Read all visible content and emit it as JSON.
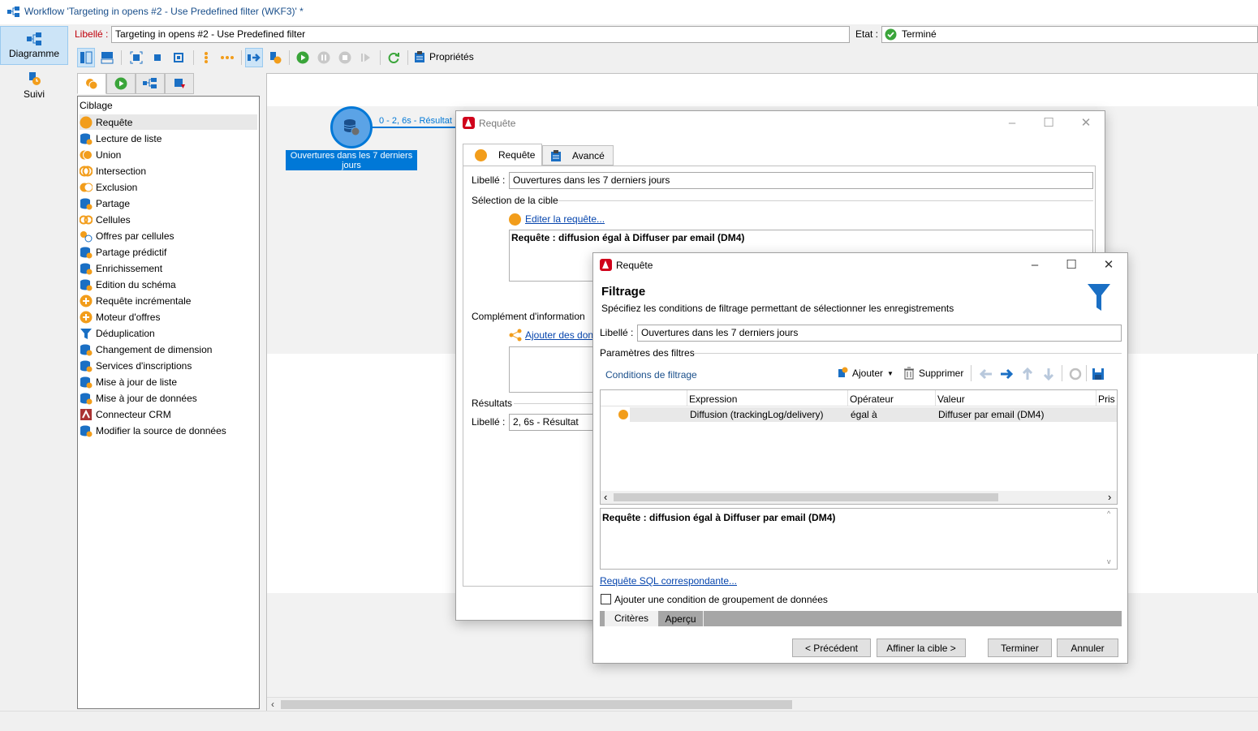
{
  "window": {
    "title": "Workflow 'Targeting in opens #2 - Use Predefined filter (WKF3)' *"
  },
  "side_nav": [
    {
      "label": "Diagramme",
      "icon": "diagram-icon"
    },
    {
      "label": "Suivi",
      "icon": "tracking-icon"
    }
  ],
  "header": {
    "libelle_label": "Libellé :",
    "libelle_value": "Targeting in opens #2 - Use Predefined filter",
    "etat_label": "Etat :",
    "etat_value": "Terminé"
  },
  "toolbar": {
    "properties_label": "Propriétés"
  },
  "palette": {
    "group": "Ciblage",
    "items": [
      {
        "label": "Requête",
        "icon": "query-icon"
      },
      {
        "label": "Lecture de liste",
        "icon": "list-read-icon"
      },
      {
        "label": "Union",
        "icon": "union-icon"
      },
      {
        "label": "Intersection",
        "icon": "intersection-icon"
      },
      {
        "label": "Exclusion",
        "icon": "exclusion-icon"
      },
      {
        "label": "Partage",
        "icon": "split-icon"
      },
      {
        "label": "Cellules",
        "icon": "cells-icon"
      },
      {
        "label": "Offres par cellules",
        "icon": "offers-cells-icon"
      },
      {
        "label": "Partage prédictif",
        "icon": "predictive-split-icon"
      },
      {
        "label": "Enrichissement",
        "icon": "enrichment-icon"
      },
      {
        "label": "Edition du schéma",
        "icon": "schema-edit-icon"
      },
      {
        "label": "Requête incrémentale",
        "icon": "incremental-query-icon"
      },
      {
        "label": "Moteur d'offres",
        "icon": "offer-engine-icon"
      },
      {
        "label": "Déduplication",
        "icon": "deduplication-icon"
      },
      {
        "label": "Changement de dimension",
        "icon": "dimension-change-icon"
      },
      {
        "label": "Services d'inscriptions",
        "icon": "subscription-services-icon"
      },
      {
        "label": "Mise à jour de liste",
        "icon": "list-update-icon"
      },
      {
        "label": "Mise à jour de données",
        "icon": "data-update-icon"
      },
      {
        "label": "Connecteur CRM",
        "icon": "crm-connector-icon"
      },
      {
        "label": "Modifier la source de données",
        "icon": "change-datasource-icon"
      }
    ]
  },
  "canvas": {
    "node_label": "Ouvertures dans les 7 derniers jours",
    "transition_label": "0 - 2, 6s - Résultat"
  },
  "query_dialog": {
    "title": "Requête",
    "tabs": [
      "Requête",
      "Avancé"
    ],
    "libelle_label": "Libellé :",
    "libelle_value": "Ouvertures dans les 7 derniers jours",
    "target_section": "Sélection de la cible",
    "edit_link": "Editer la requête...",
    "query_text": "Requête : diffusion égal à Diffuser par email (DM4)",
    "complement_section": "Complément d'information",
    "add_data_link": "Ajouter des don",
    "results_section": "Résultats",
    "result_label": "Libellé :",
    "result_value": "2, 6s - Résultat"
  },
  "filter_dialog": {
    "title": "Requête",
    "heading": "Filtrage",
    "subheading": "Spécifiez les conditions de filtrage permettant de sélectionner les enregistrements",
    "libelle_label": "Libellé :",
    "libelle_value": "Ouvertures dans les 7 derniers jours",
    "params_section": "Paramètres des filtres",
    "conditions_label": "Conditions de filtrage",
    "add_label": "Ajouter",
    "delete_label": "Supprimer",
    "columns": [
      "Expression",
      "Opérateur",
      "Valeur",
      "Pris"
    ],
    "rows": [
      {
        "expression": "Diffusion (trackingLog/delivery)",
        "operator": "égal à",
        "value": "Diffuser par email (DM4)"
      }
    ],
    "query_text": "Requête : diffusion égal à Diffuser par email (DM4)",
    "sql_link": "Requête SQL correspondante...",
    "group_checkbox_label": "Ajouter une condition de groupement de données",
    "bottom_tabs": [
      "Critères",
      "Aperçu"
    ],
    "buttons": {
      "previous": "< Précédent",
      "refine": "Affiner la cible >",
      "finish": "Terminer",
      "cancel": "Annuler"
    }
  },
  "colors": {
    "accent": "#0078d7",
    "orange": "#f29d1b",
    "green": "#3aa53a",
    "link": "#0645ad"
  }
}
